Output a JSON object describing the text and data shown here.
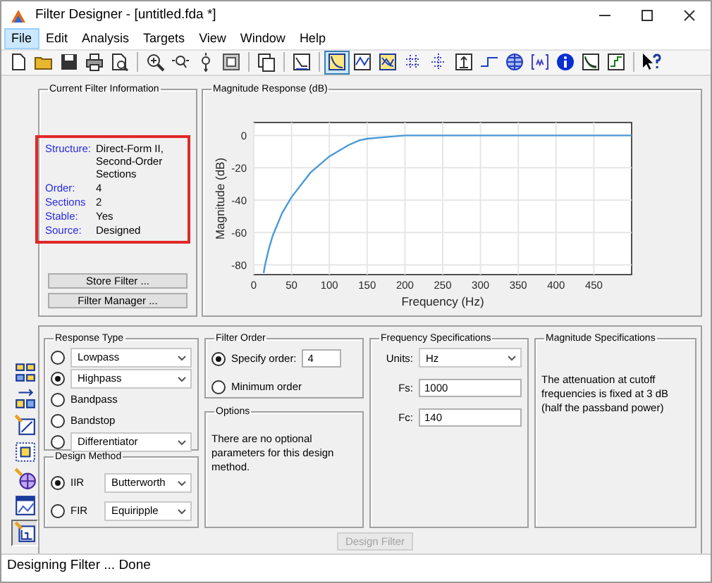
{
  "window": {
    "title": "Filter Designer -  [untitled.fda *]"
  },
  "menu": [
    {
      "label": "File",
      "selected": true
    },
    {
      "label": "Edit",
      "selected": false
    },
    {
      "label": "Analysis",
      "selected": false
    },
    {
      "label": "Targets",
      "selected": false
    },
    {
      "label": "View",
      "selected": false
    },
    {
      "label": "Window",
      "selected": false
    },
    {
      "label": "Help",
      "selected": false
    }
  ],
  "toolbar_groups": [
    {
      "buttons": [
        {
          "kind": "new",
          "selected": false
        },
        {
          "kind": "open",
          "selected": false
        },
        {
          "kind": "save",
          "selected": false
        },
        {
          "kind": "print",
          "selected": false
        },
        {
          "kind": "preview",
          "selected": false
        }
      ]
    },
    {
      "buttons": [
        {
          "kind": "zoomin",
          "selected": false
        },
        {
          "kind": "zoomx",
          "selected": false
        },
        {
          "kind": "zoomy",
          "selected": false
        },
        {
          "kind": "fullview",
          "selected": false
        }
      ]
    },
    {
      "buttons": [
        {
          "kind": "newwindow",
          "selected": false
        }
      ]
    },
    {
      "buttons": [
        {
          "kind": "specs",
          "selected": false
        }
      ]
    },
    {
      "buttons": [
        {
          "kind": "magnitude",
          "selected": true
        },
        {
          "kind": "phase",
          "selected": false
        },
        {
          "kind": "magphase",
          "selected": false
        },
        {
          "kind": "groupdelay",
          "selected": false
        },
        {
          "kind": "phasedelay",
          "selected": false
        },
        {
          "kind": "impulse",
          "selected": false
        },
        {
          "kind": "step",
          "selected": false
        },
        {
          "kind": "polezero",
          "selected": false
        },
        {
          "kind": "coeffs",
          "selected": false
        },
        {
          "kind": "info",
          "selected": false
        },
        {
          "kind": "magest",
          "selected": false
        },
        {
          "kind": "noise",
          "selected": false
        }
      ]
    },
    {
      "buttons": [
        {
          "kind": "help",
          "selected": false
        }
      ]
    }
  ],
  "side_toolbar": [
    {
      "kind": "transform",
      "selected": false
    },
    {
      "kind": "convert",
      "selected": false
    },
    {
      "kind": "pole",
      "selected": false
    },
    {
      "kind": "realize",
      "selected": false
    },
    {
      "kind": "import",
      "selected": false
    },
    {
      "kind": "quantize",
      "selected": false
    },
    {
      "kind": "design",
      "selected": true
    }
  ],
  "filter_info": {
    "title": "Current Filter Information",
    "highlighted": true,
    "rows": [
      {
        "label": "Structure:",
        "value": "Direct-Form II, Second-Order Sections"
      },
      {
        "label": "Order:",
        "value": "4"
      },
      {
        "label": "Sections",
        "value": "2"
      },
      {
        "label": "Stable:",
        "value": "Yes"
      },
      {
        "label": "Source:",
        "value": "Designed"
      }
    ],
    "buttons": [
      "Store Filter ...",
      "Filter Manager ..."
    ]
  },
  "chart_panel": {
    "title": "Magnitude Response (dB)",
    "chart_data": {
      "type": "line",
      "xlabel": "Frequency (Hz)",
      "ylabel": "Magnitude (dB)",
      "x": [
        13,
        15,
        20,
        25,
        37.5,
        50,
        75,
        100,
        125,
        140,
        150,
        175,
        200,
        250,
        300,
        350,
        400,
        450,
        500
      ],
      "xlim": [
        0,
        500
      ],
      "ylim": [
        -86,
        8
      ],
      "xticks": [
        0,
        50,
        100,
        150,
        200,
        250,
        300,
        350,
        400,
        450
      ],
      "yticks": [
        -80,
        -60,
        -40,
        -20,
        0
      ],
      "grid": true,
      "series": [
        {
          "color": "#4a9ad8",
          "values": [
            -85,
            -80,
            -70,
            -62,
            -48,
            -38,
            -23,
            -13,
            -6,
            -3,
            -2,
            -1,
            0,
            0,
            0,
            0,
            0,
            0,
            0
          ]
        }
      ]
    }
  },
  "response_type": {
    "title": "Response Type",
    "options": [
      {
        "label": "Lowpass",
        "selected": false,
        "kind": "dropdown"
      },
      {
        "label": "Highpass",
        "selected": true,
        "kind": "dropdown"
      },
      {
        "label": "Bandpass",
        "selected": false,
        "kind": "plain"
      },
      {
        "label": "Bandstop",
        "selected": false,
        "kind": "plain"
      },
      {
        "label": "Differentiator",
        "selected": false,
        "kind": "dropdown"
      }
    ]
  },
  "design_method": {
    "title": "Design Method",
    "options": [
      {
        "label": "IIR",
        "selected": true,
        "value": "Butterworth"
      },
      {
        "label": "FIR",
        "selected": false,
        "value": "Equiripple"
      }
    ]
  },
  "filter_order": {
    "title": "Filter Order",
    "options": [
      {
        "label": "Specify order:",
        "selected": true,
        "value": "4"
      },
      {
        "label": "Minimum order",
        "selected": false
      }
    ]
  },
  "options": {
    "title": "Options",
    "text": "There are no optional parameters for this design method."
  },
  "frequency_specs": {
    "title": "Frequency Specifications",
    "fields": [
      {
        "label": "Units:",
        "kind": "dropdown",
        "value": "Hz"
      },
      {
        "label": "Fs:",
        "kind": "input",
        "value": "1000"
      },
      {
        "label": "Fc:",
        "kind": "input",
        "value": "140"
      }
    ]
  },
  "magnitude_specs": {
    "title": "Magnitude Specifications",
    "text": "The attenuation at cutoff frequencies is fixed at 3 dB (half the passband power)"
  },
  "design_button": {
    "label": "Design Filter",
    "disabled": true
  },
  "status_bar": "Designing Filter ... Done"
}
